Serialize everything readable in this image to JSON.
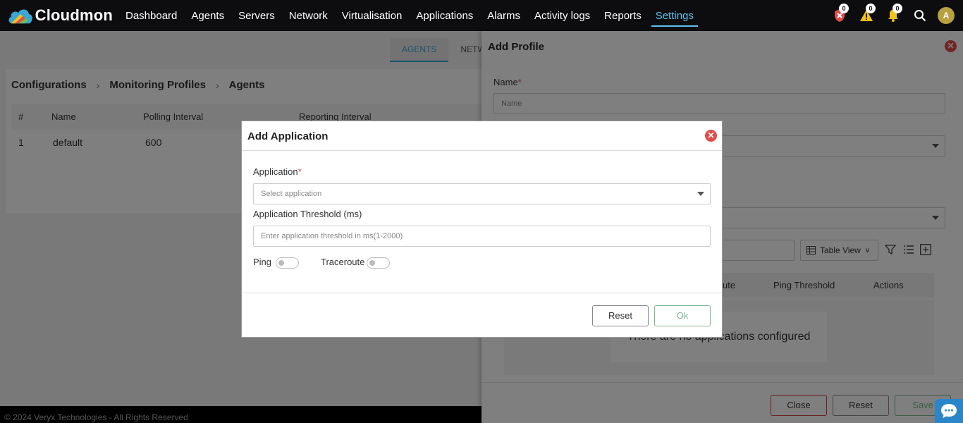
{
  "app": {
    "brand": "Cloudmon",
    "colors": {
      "accent": "#5ec3ec",
      "danger": "#e24b4b",
      "warning": "#f2c21b",
      "ok": "#7ab893"
    }
  },
  "nav": {
    "items": [
      "Dashboard",
      "Agents",
      "Servers",
      "Network",
      "Virtualisation",
      "Applications",
      "Alarms",
      "Activity logs",
      "Reports",
      "Settings"
    ],
    "active": "Settings",
    "critical_count": "0",
    "warning_count": "0",
    "notification_count": "0",
    "avatar_initial": "A"
  },
  "page": {
    "tabs": [
      "AGENTS",
      "NETW"
    ],
    "breadcrumb": [
      "Configurations",
      "Monitoring Profiles",
      "Agents"
    ],
    "table": {
      "headers": [
        "#",
        "Name",
        "Polling Interval",
        "Reporting Interval"
      ],
      "rows": [
        [
          "1",
          "default",
          "600",
          ""
        ]
      ]
    },
    "footer": "© 2024 Veryx Technologies - All Rights Reserved"
  },
  "drawer": {
    "title": "Add Profile",
    "name_label": "Name",
    "name_placeholder": "Name",
    "view_label": "Table View",
    "grid_headers": [
      "ute",
      "Ping Threshold",
      "Actions"
    ],
    "empty_message": "There are no applications configured",
    "close_label": "Close",
    "reset_label": "Reset",
    "save_label": "Save"
  },
  "modal": {
    "title": "Add Application",
    "application_label": "Application",
    "application_placeholder": "Select application",
    "threshold_label": "Application Threshold (ms)",
    "threshold_placeholder": "Enter application threshold in ms(1-2000)",
    "ping_label": "Ping",
    "traceroute_label": "Traceroute",
    "reset_label": "Reset",
    "ok_label": "Ok"
  }
}
